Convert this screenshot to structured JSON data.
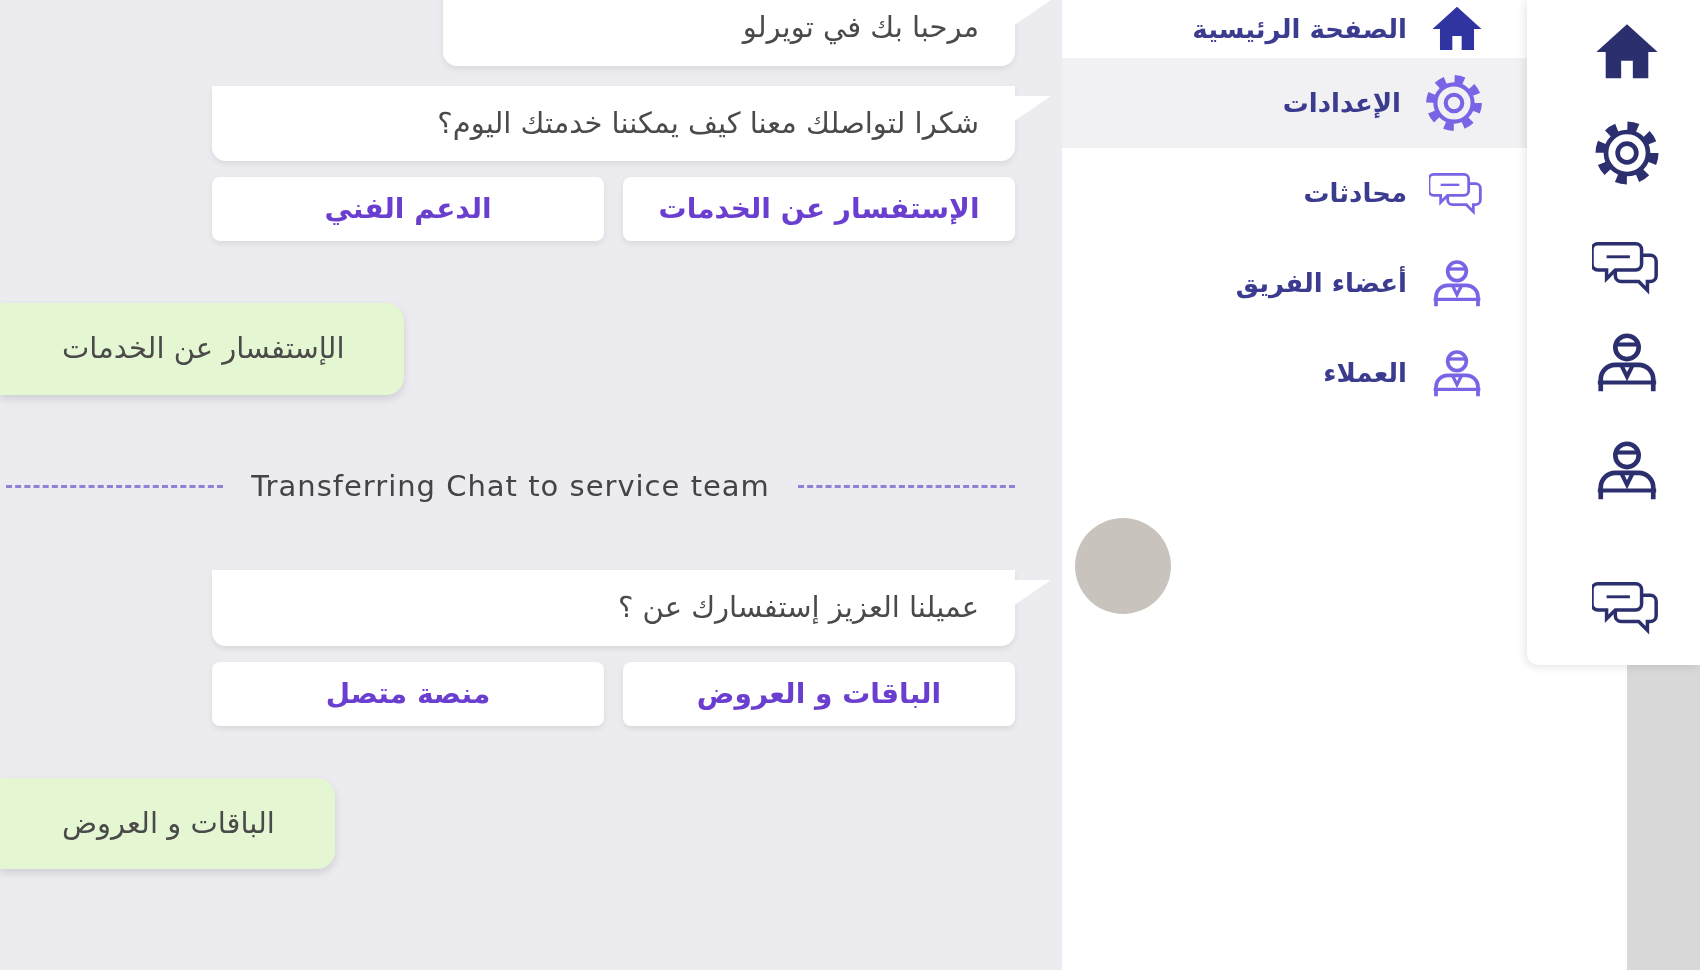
{
  "chat": {
    "messages": [
      {
        "kind": "bot",
        "text": "مرحبا بك في تويرلو"
      },
      {
        "kind": "bot",
        "text": "شكرا لتواصلك معنا كيف يمكننا خدمتك اليوم؟",
        "options": [
          "الإستفسار عن الخدمات",
          "الدعم الفني"
        ]
      },
      {
        "kind": "user",
        "text": "الإستفسار عن الخدمات"
      },
      {
        "kind": "divider",
        "text": "Transferring Chat to service team"
      },
      {
        "kind": "bot",
        "text": "عميلنا العزيز إستفسارك عن ؟",
        "options": [
          "الباقات و العروض",
          "منصة متصل"
        ]
      },
      {
        "kind": "user",
        "text": "الباقات و العروض"
      }
    ]
  },
  "sidebar": {
    "items": [
      {
        "label": "الصفحة الرئيسية",
        "selected": false
      },
      {
        "label": "الإعدادات",
        "selected": true
      },
      {
        "label": "محادثات",
        "selected": false
      },
      {
        "label": "أعضاء الفريق",
        "selected": false
      },
      {
        "label": "العملاء",
        "selected": false
      }
    ]
  }
}
